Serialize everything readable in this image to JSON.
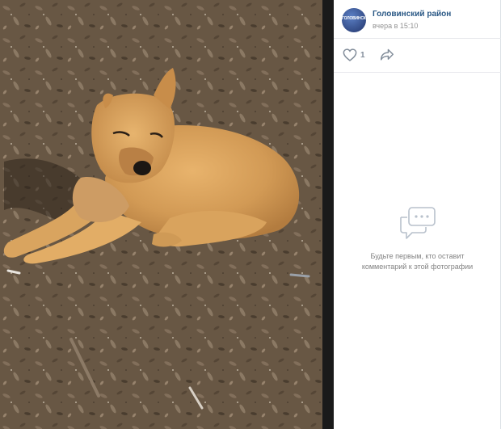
{
  "post": {
    "author": "Головинский район",
    "time": "вчера в 15:10",
    "avatar_text": "ГОЛОВИНСКИЙ\nРАЙОН"
  },
  "actions": {
    "like_count": "1",
    "like_icon": "heart-icon",
    "share_icon": "share-arrow-icon"
  },
  "comments": {
    "empty_line1": "Будьте первым, кто оставит",
    "empty_line2": "комментарий к этой фотографии",
    "empty_icon": "comments-icon"
  },
  "colors": {
    "link": "#2a5885",
    "muted": "#818c99",
    "divider": "#1a1a1a"
  }
}
